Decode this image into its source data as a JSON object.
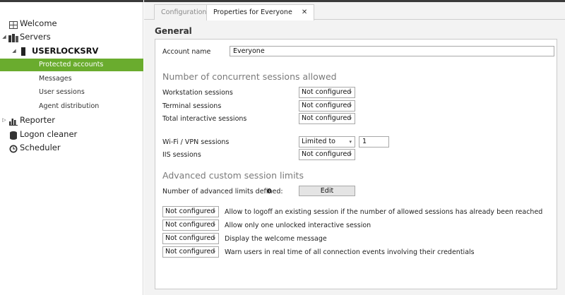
{
  "sidebar": {
    "welcome": "Welcome",
    "servers": "Servers",
    "server_name": "USERLOCKSRV",
    "protected_accounts": "Protected accounts",
    "messages": "Messages",
    "user_sessions": "User sessions",
    "agent_distribution": "Agent distribution",
    "reporter": "Reporter",
    "logon_cleaner": "Logon cleaner",
    "scheduler": "Scheduler"
  },
  "tabs": {
    "configuration": "Configuration",
    "properties": "Properties for Everyone",
    "close": "✕"
  },
  "general": {
    "heading": "General",
    "account_name_label": "Account name",
    "account_name_value": "Everyone"
  },
  "sessions": {
    "heading": "Number of concurrent sessions allowed",
    "workstation_label": "Workstation sessions",
    "workstation_value": "Not configured",
    "terminal_label": "Terminal sessions",
    "terminal_value": "Not configured",
    "total_label": "Total interactive sessions",
    "total_value": "Not configured",
    "wifi_label": "Wi-Fi / VPN sessions",
    "wifi_value": "Limited to",
    "wifi_limit": "1",
    "iis_label": "IIS sessions",
    "iis_value": "Not configured"
  },
  "advanced": {
    "heading": "Advanced custom session limits",
    "count_label": "Number of advanced limits defined:",
    "count_value": "0",
    "edit_button": "Edit",
    "options": [
      {
        "value": "Not configured",
        "label": "Allow to logoff an existing session if the number of allowed sessions has already been reached"
      },
      {
        "value": "Not configured",
        "label": "Allow only one unlocked interactive session"
      },
      {
        "value": "Not configured",
        "label": "Display the welcome message"
      },
      {
        "value": "Not configured",
        "label": "Warn users in real time of all connection events involving their credentials"
      }
    ]
  },
  "icons": {
    "caret": "▾",
    "expanded": "◢",
    "collapsed": "▷"
  },
  "colors": {
    "selection": "#6aac2e",
    "section_heading": "#7a7a7a"
  }
}
